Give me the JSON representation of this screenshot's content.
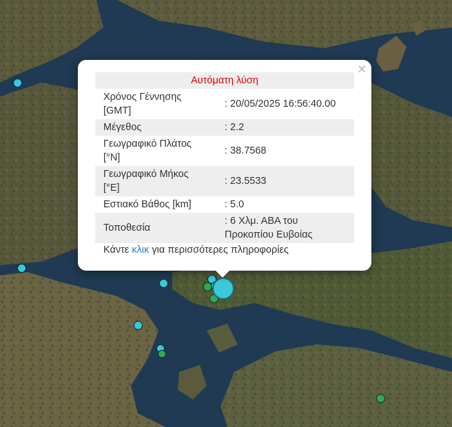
{
  "popup": {
    "header": "Αυτόματη λύση",
    "close_symbol": "×",
    "rows": [
      {
        "label": "Χρόνος Γέννησης [GMT]",
        "value": ": 20/05/2025 16:56:40.00"
      },
      {
        "label": "Μέγεθος",
        "value": ": 2.2"
      },
      {
        "label": "Γεωγραφικό Πλάτος [°N]",
        "value": ": 38.7568"
      },
      {
        "label": "Γεωγραφικό Μήκος [°E]",
        "value": ": 23.5533"
      },
      {
        "label": "Εστιακό Βάθος [km]",
        "value": ": 5.0"
      },
      {
        "label": "Τοποθεσία",
        "value": ": 6 Χλμ. ΑΒΑ του Προκοπίου Ευβοίας"
      }
    ],
    "more_prefix": "Κάντε",
    "more_link": "κλικ",
    "more_suffix": "για περισσότερες πληροφορίες"
  },
  "colors": {
    "header_text": "#e00000",
    "link": "#2a7db5",
    "marker_cyan": "#3cc8d6",
    "marker_green": "#35a852",
    "sea": "#1f3a52"
  }
}
